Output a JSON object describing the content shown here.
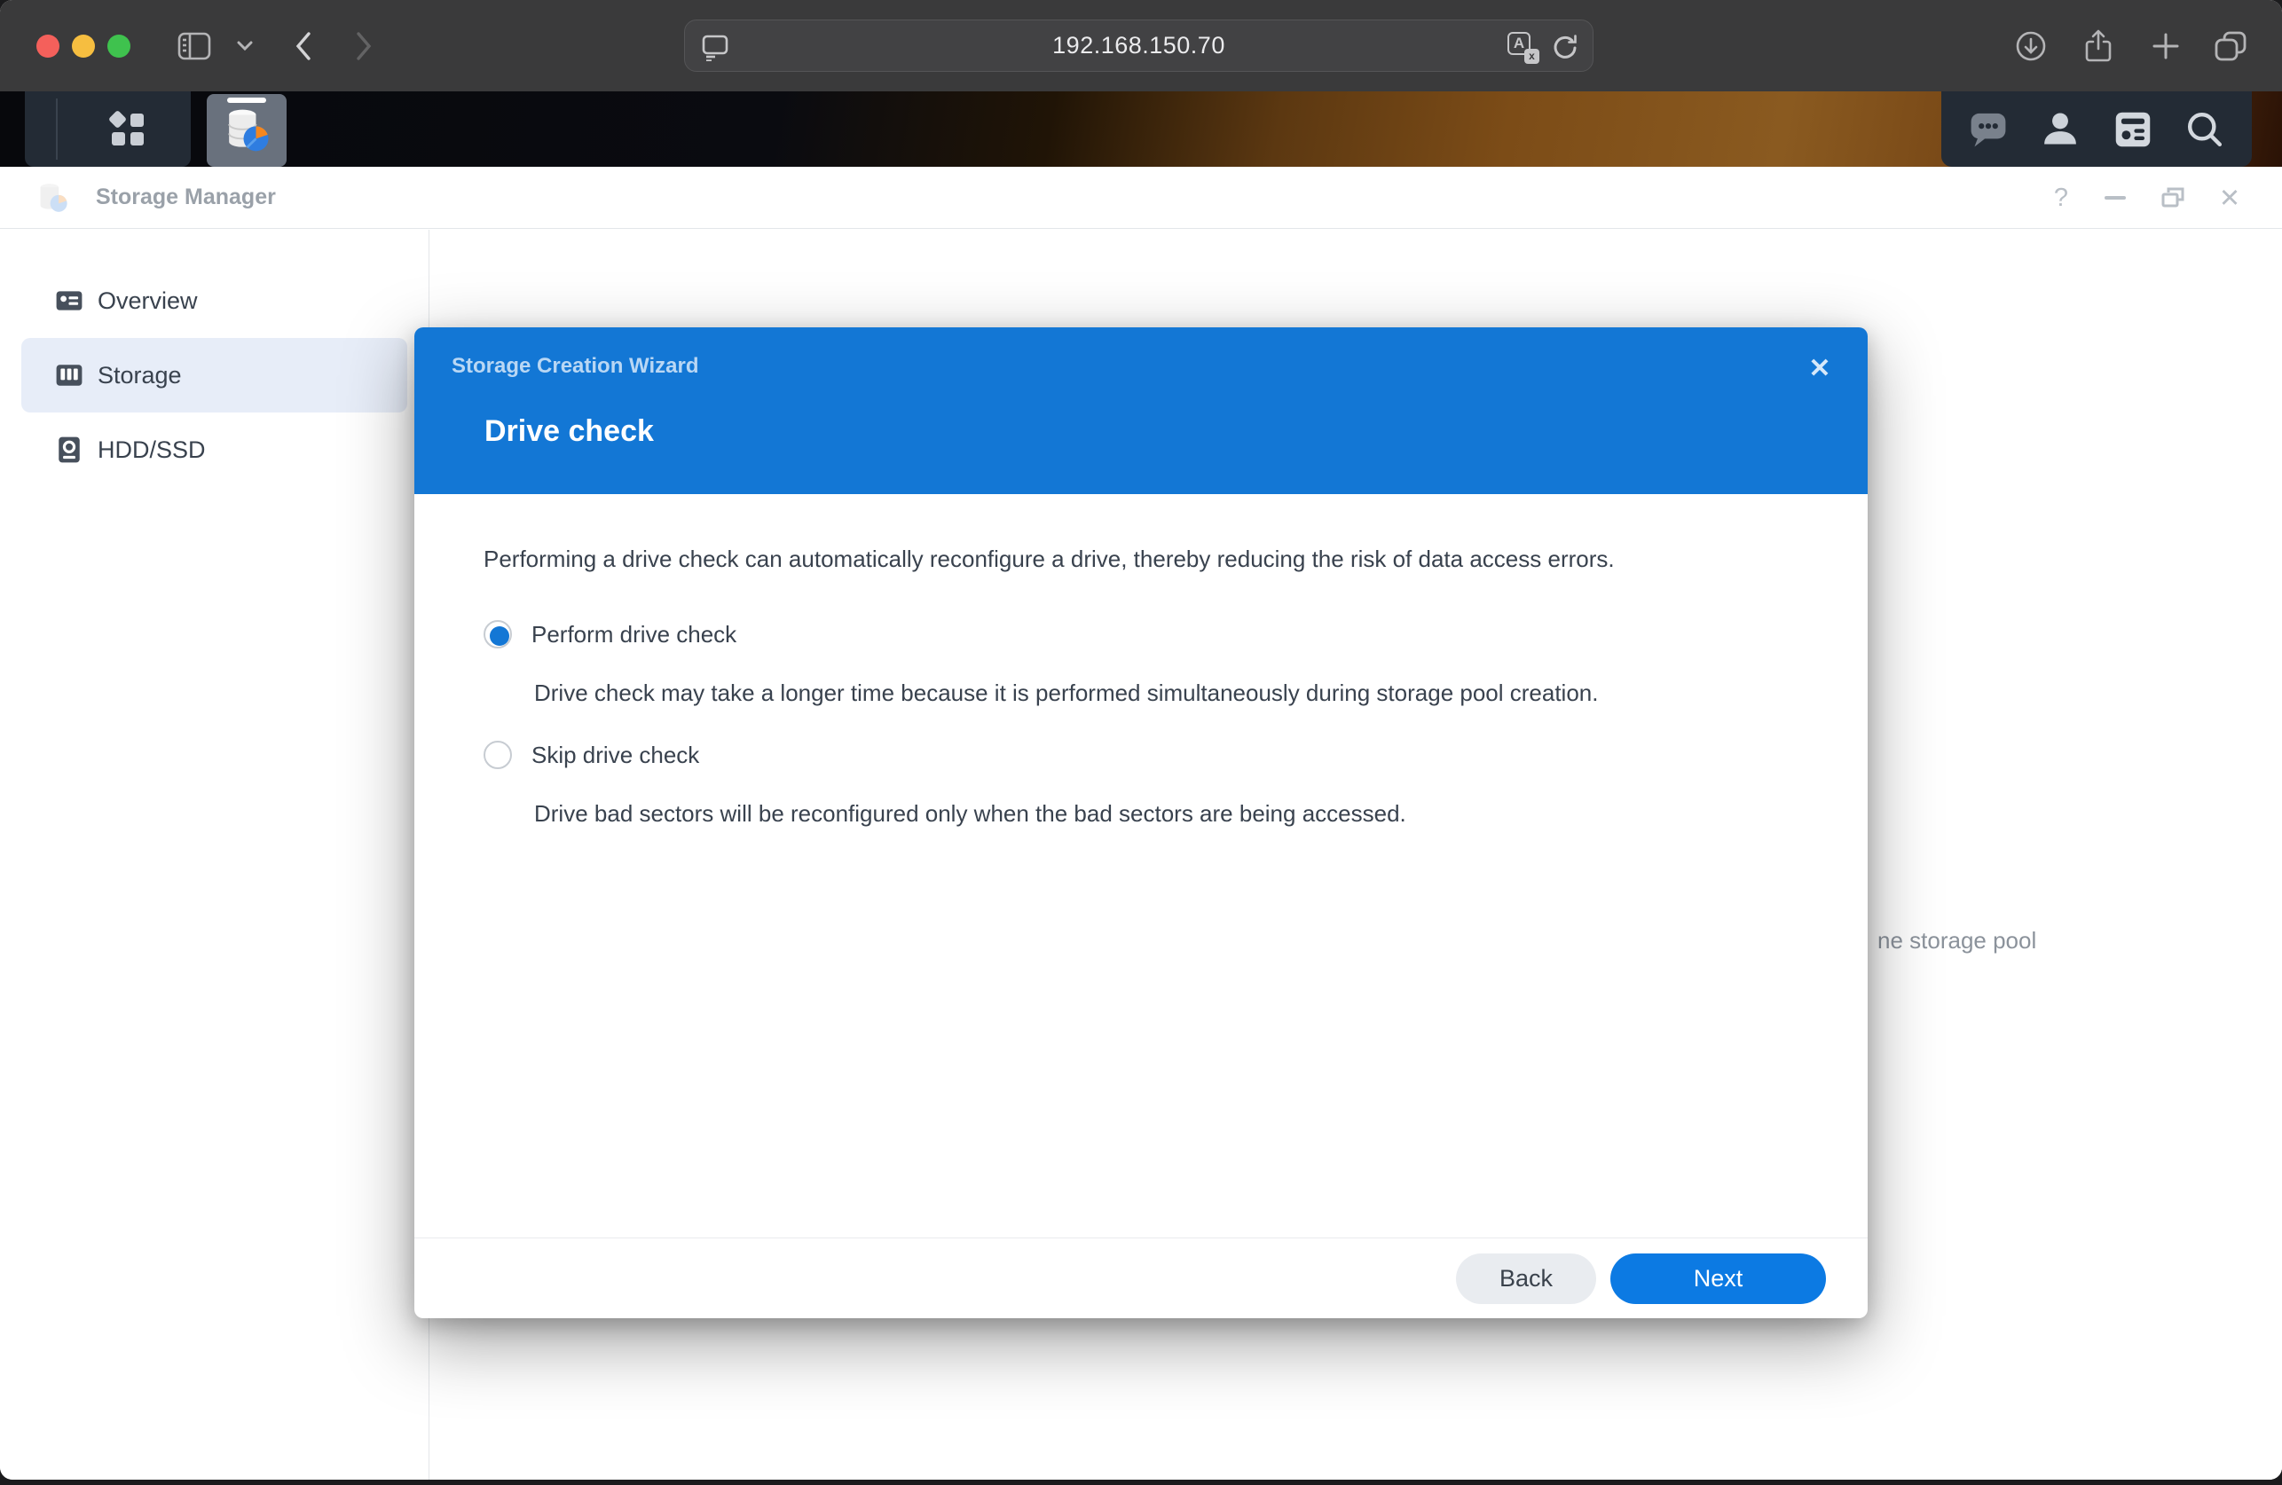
{
  "browser": {
    "url": "192.168.150.70"
  },
  "app": {
    "title": "Storage Manager",
    "sidebar": [
      {
        "label": "Overview",
        "selected": false
      },
      {
        "label": "Storage",
        "selected": true
      },
      {
        "label": "HDD/SSD",
        "selected": false
      }
    ],
    "background_text": "ne storage pool"
  },
  "wizard": {
    "title": "Storage Creation Wizard",
    "heading": "Drive check",
    "description": "Performing a drive check can automatically reconfigure a drive, thereby reducing the risk of data access errors.",
    "options": [
      {
        "label": "Perform drive check",
        "description": "Drive check may take a longer time because it is performed simultaneously during storage pool creation.",
        "selected": true
      },
      {
        "label": "Skip drive check",
        "description": "Drive bad sectors will be reconfigured only when the bad sectors are being accessed.",
        "selected": false
      }
    ],
    "buttons": {
      "back": "Back",
      "next": "Next"
    }
  },
  "icons_text": {
    "help": "?",
    "close": "✕",
    "translate_a": "A",
    "translate_x": "x"
  },
  "colors": {
    "wizard_header_blue": "#1377d5",
    "accent_blue": "#0c7ae3",
    "selected_sidebar_bg": "#e7edf8",
    "browser_bar": "#3a3a3b",
    "dsm_tray": "#232b35"
  }
}
